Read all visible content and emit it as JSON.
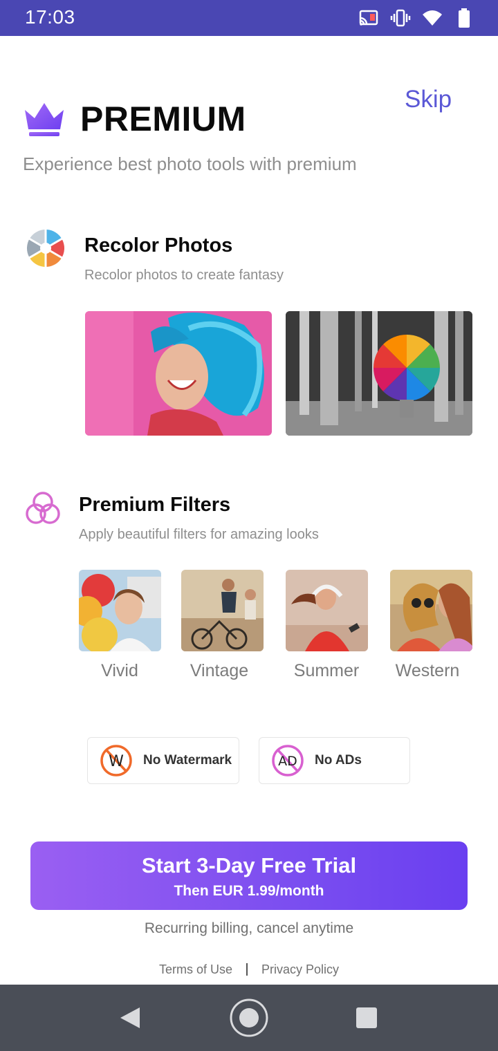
{
  "status_bar": {
    "time": "17:03",
    "icons": [
      "cast-icon",
      "vibrate-icon",
      "wifi-icon",
      "battery-icon"
    ]
  },
  "header": {
    "skip_label": "Skip",
    "title": "PREMIUM",
    "subtitle": "Experience best photo tools with premium",
    "crown_icon": "crown-icon"
  },
  "features": [
    {
      "icon": "color-wheel-icon",
      "title": "Recolor Photos",
      "description": "Recolor photos to create fantasy"
    },
    {
      "icon": "filter-circles-icon",
      "title": "Premium Filters",
      "description": "Apply beautiful filters for amazing looks"
    }
  ],
  "filters": [
    {
      "label": "Vivid"
    },
    {
      "label": "Vintage"
    },
    {
      "label": "Summer"
    },
    {
      "label": "Western"
    }
  ],
  "perks": [
    {
      "icon": "no-watermark-icon",
      "label": "No Watermark"
    },
    {
      "icon": "no-ads-icon",
      "label": "No ADs"
    }
  ],
  "cta": {
    "title": "Start 3-Day Free Trial",
    "subtitle": "Then EUR 1.99/month",
    "billing_note": "Recurring billing, cancel anytime"
  },
  "footer": {
    "terms": "Terms of Use",
    "privacy": "Privacy Policy"
  },
  "colors": {
    "status_bar": "#4a47b3",
    "accent": "#5b58d6",
    "cta_start": "#9a5ff2",
    "cta_end": "#6a3ff0",
    "nav_bar": "#4a4e57"
  }
}
